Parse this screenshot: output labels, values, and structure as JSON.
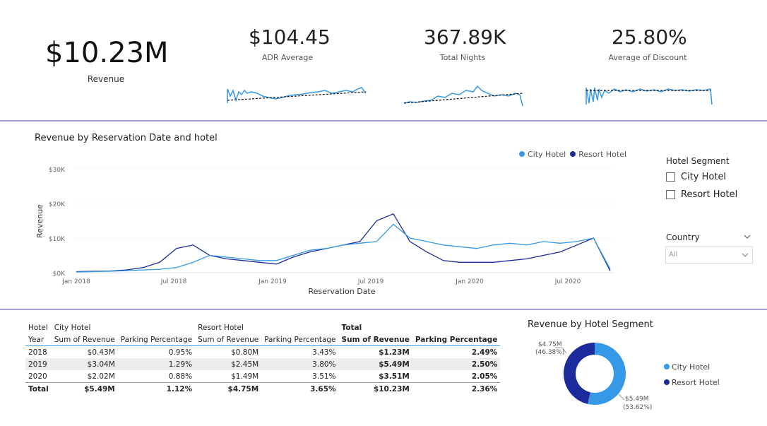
{
  "kpis": {
    "revenue": {
      "value": "$10.23M",
      "label": "Revenue"
    },
    "adr": {
      "value": "$104.45",
      "label": "ADR Average"
    },
    "nights": {
      "value": "367.89K",
      "label": "Total Nights"
    },
    "discount": {
      "value": "25.80%",
      "label": "Average of Discount"
    }
  },
  "colors": {
    "city": "#3599e8",
    "resort": "#1c2b9c",
    "divider": "#a79ed6"
  },
  "line_chart": {
    "title": "Revenue by Reservation Date and hotel",
    "legend": [
      "City Hotel",
      "Resort Hotel"
    ],
    "y_ticks": [
      "$30K",
      "$20K",
      "$10K",
      "$0K"
    ],
    "x_ticks": [
      "Jan 2018",
      "Jul 2018",
      "Jan 2019",
      "Jul 2019",
      "Jan 2020",
      "Jul 2020"
    ],
    "ylabel": "Revenue",
    "xlabel": "Reservation Date"
  },
  "chart_data": [
    {
      "type": "line",
      "title": "Revenue by Reservation Date and hotel",
      "xlabel": "Reservation Date",
      "ylabel": "Revenue",
      "ylim": [
        0,
        30000
      ],
      "x": [
        "2018-01",
        "2018-02",
        "2018-03",
        "2018-04",
        "2018-05",
        "2018-06",
        "2018-07",
        "2018-08",
        "2018-09",
        "2018-10",
        "2018-11",
        "2018-12",
        "2019-01",
        "2019-02",
        "2019-03",
        "2019-04",
        "2019-05",
        "2019-06",
        "2019-07",
        "2019-08",
        "2019-09",
        "2019-10",
        "2019-11",
        "2019-12",
        "2020-01",
        "2020-02",
        "2020-03",
        "2020-04",
        "2020-05",
        "2020-06",
        "2020-07",
        "2020-08",
        "2020-09"
      ],
      "series": [
        {
          "name": "City Hotel",
          "values": [
            200,
            300,
            400,
            600,
            800,
            1000,
            1500,
            3000,
            5000,
            4500,
            4000,
            3500,
            3500,
            5000,
            6500,
            7000,
            8000,
            8500,
            9000,
            14000,
            10000,
            9000,
            8000,
            7500,
            7000,
            8000,
            8500,
            8000,
            9000,
            8500,
            9000,
            10000,
            1000
          ]
        },
        {
          "name": "Resort Hotel",
          "values": [
            300,
            400,
            500,
            800,
            1500,
            3000,
            7000,
            8000,
            5000,
            4000,
            3500,
            3000,
            2500,
            4500,
            6000,
            7000,
            8000,
            9000,
            15000,
            17000,
            9000,
            6000,
            3500,
            3000,
            3000,
            3000,
            3500,
            4000,
            5000,
            6000,
            8000,
            10000,
            500
          ]
        }
      ]
    },
    {
      "type": "table",
      "columns": [
        "Year",
        "City Hotel Sum of Revenue",
        "City Hotel Parking Percentage",
        "Resort Hotel Sum of Revenue",
        "Resort Hotel Parking Percentage",
        "Total Sum of Revenue",
        "Total Parking Percentage"
      ],
      "rows": [
        [
          "2018",
          "$0.43M",
          "0.95%",
          "$0.80M",
          "3.43%",
          "$1.23M",
          "2.49%"
        ],
        [
          "2019",
          "$3.04M",
          "1.29%",
          "$2.45M",
          "3.80%",
          "$5.49M",
          "2.50%"
        ],
        [
          "2020",
          "$2.02M",
          "0.88%",
          "$1.49M",
          "3.51%",
          "$3.51M",
          "2.05%"
        ],
        [
          "Total",
          "$5.49M",
          "1.12%",
          "$4.75M",
          "3.65%",
          "$10.23M",
          "2.36%"
        ]
      ]
    },
    {
      "type": "pie",
      "title": "Revenue by Hotel Segment",
      "categories": [
        "City Hotel",
        "Resort Hotel"
      ],
      "values": [
        5.49,
        4.75
      ],
      "percents": [
        53.62,
        46.38
      ]
    }
  ],
  "slicer": {
    "title": "Hotel Segment",
    "options": [
      "City Hotel",
      "Resort Hotel"
    ],
    "country_title": "Country",
    "country_value": "All"
  },
  "matrix": {
    "header1": [
      "Hotel",
      "City Hotel",
      "",
      "Resort Hotel",
      "",
      "Total",
      ""
    ],
    "header2": [
      "Year",
      "Sum of Revenue",
      "Parking Percentage",
      "Sum of Revenue",
      "Parking Percentage",
      "Sum of Revenue",
      "Parking Percentage"
    ],
    "rows": [
      [
        "2018",
        "$0.43M",
        "0.95%",
        "$0.80M",
        "3.43%",
        "$1.23M",
        "2.49%"
      ],
      [
        "2019",
        "$3.04M",
        "1.29%",
        "$2.45M",
        "3.80%",
        "$5.49M",
        "2.50%"
      ],
      [
        "2020",
        "$2.02M",
        "0.88%",
        "$1.49M",
        "3.51%",
        "$3.51M",
        "2.05%"
      ]
    ],
    "total": [
      "Total",
      "$5.49M",
      "1.12%",
      "$4.75M",
      "3.65%",
      "$10.23M",
      "2.36%"
    ]
  },
  "donut": {
    "title": "Revenue by Hotel Segment",
    "resort_label": "$4.75M",
    "resort_pct": "(46.38%)",
    "city_label": "$5.49M",
    "city_pct": "(53.62%)",
    "legend": [
      "City Hotel",
      "Resort Hotel"
    ]
  }
}
